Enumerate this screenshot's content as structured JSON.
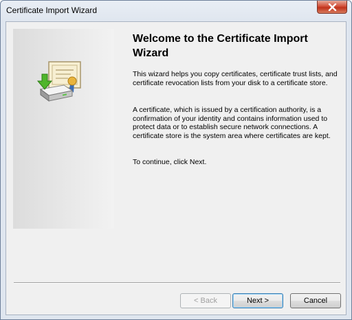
{
  "window": {
    "title": "Certificate Import Wizard"
  },
  "wizard": {
    "heading": "Welcome to the Certificate Import Wizard",
    "paragraphs": [
      "This wizard helps you copy certificates, certificate trust lists, and certificate revocation lists from your disk to a certificate store.",
      "A certificate, which is issued by a certification authority, is a confirmation of your identity and contains information used to protect data or to establish secure network connections. A certificate store is the system area where certificates are kept.",
      "To continue, click Next."
    ]
  },
  "buttons": {
    "back": "< Back",
    "next": "Next >",
    "cancel": "Cancel"
  },
  "icons": {
    "banner": "certificate-import-icon",
    "close": "close-icon"
  },
  "colors": {
    "close_button": "#c8402a",
    "next_focus": "#3c7fb1"
  }
}
